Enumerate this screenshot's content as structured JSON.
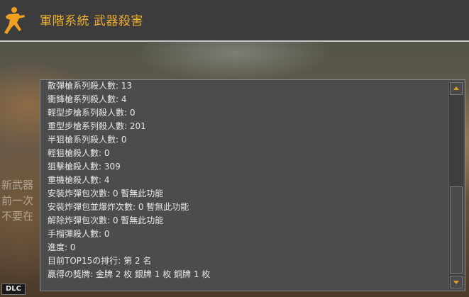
{
  "window": {
    "title": "軍階系統 武器殺害",
    "logo_icon": "counter-strike-logo-icon",
    "accent_color": "#f0b030"
  },
  "background_text": [
    "新武器",
    "前一次",
    "不要在"
  ],
  "stats": [
    "散彈槍系列殺人數: 13",
    "衝鋒槍系列殺人數: 4",
    "輕型步槍系列殺人數: 0",
    "重型步槍系列殺人數: 201",
    "半狙槍系列殺人數: 0",
    "輕狙槍殺人數: 0",
    "狙擊槍殺人數: 309",
    "重機槍殺人數: 4",
    "安裝炸彈包次數: 0 暫無此功能",
    "安裝炸彈包並爆炸次數: 0 暫無此功能",
    "解除炸彈包次數: 0 暫無此功能",
    "手榴彈殺人數: 0",
    "進度: 0",
    "目前TOP15の排行: 第 2 名",
    "贏得の獎牌: 金牌 2 枚 銀牌 1 枚 銅牌 1 枚"
  ],
  "scrollbar": {
    "up_icon": "arrow-up-icon",
    "down_icon": "arrow-down-icon"
  },
  "badge": {
    "label": "DLC"
  }
}
